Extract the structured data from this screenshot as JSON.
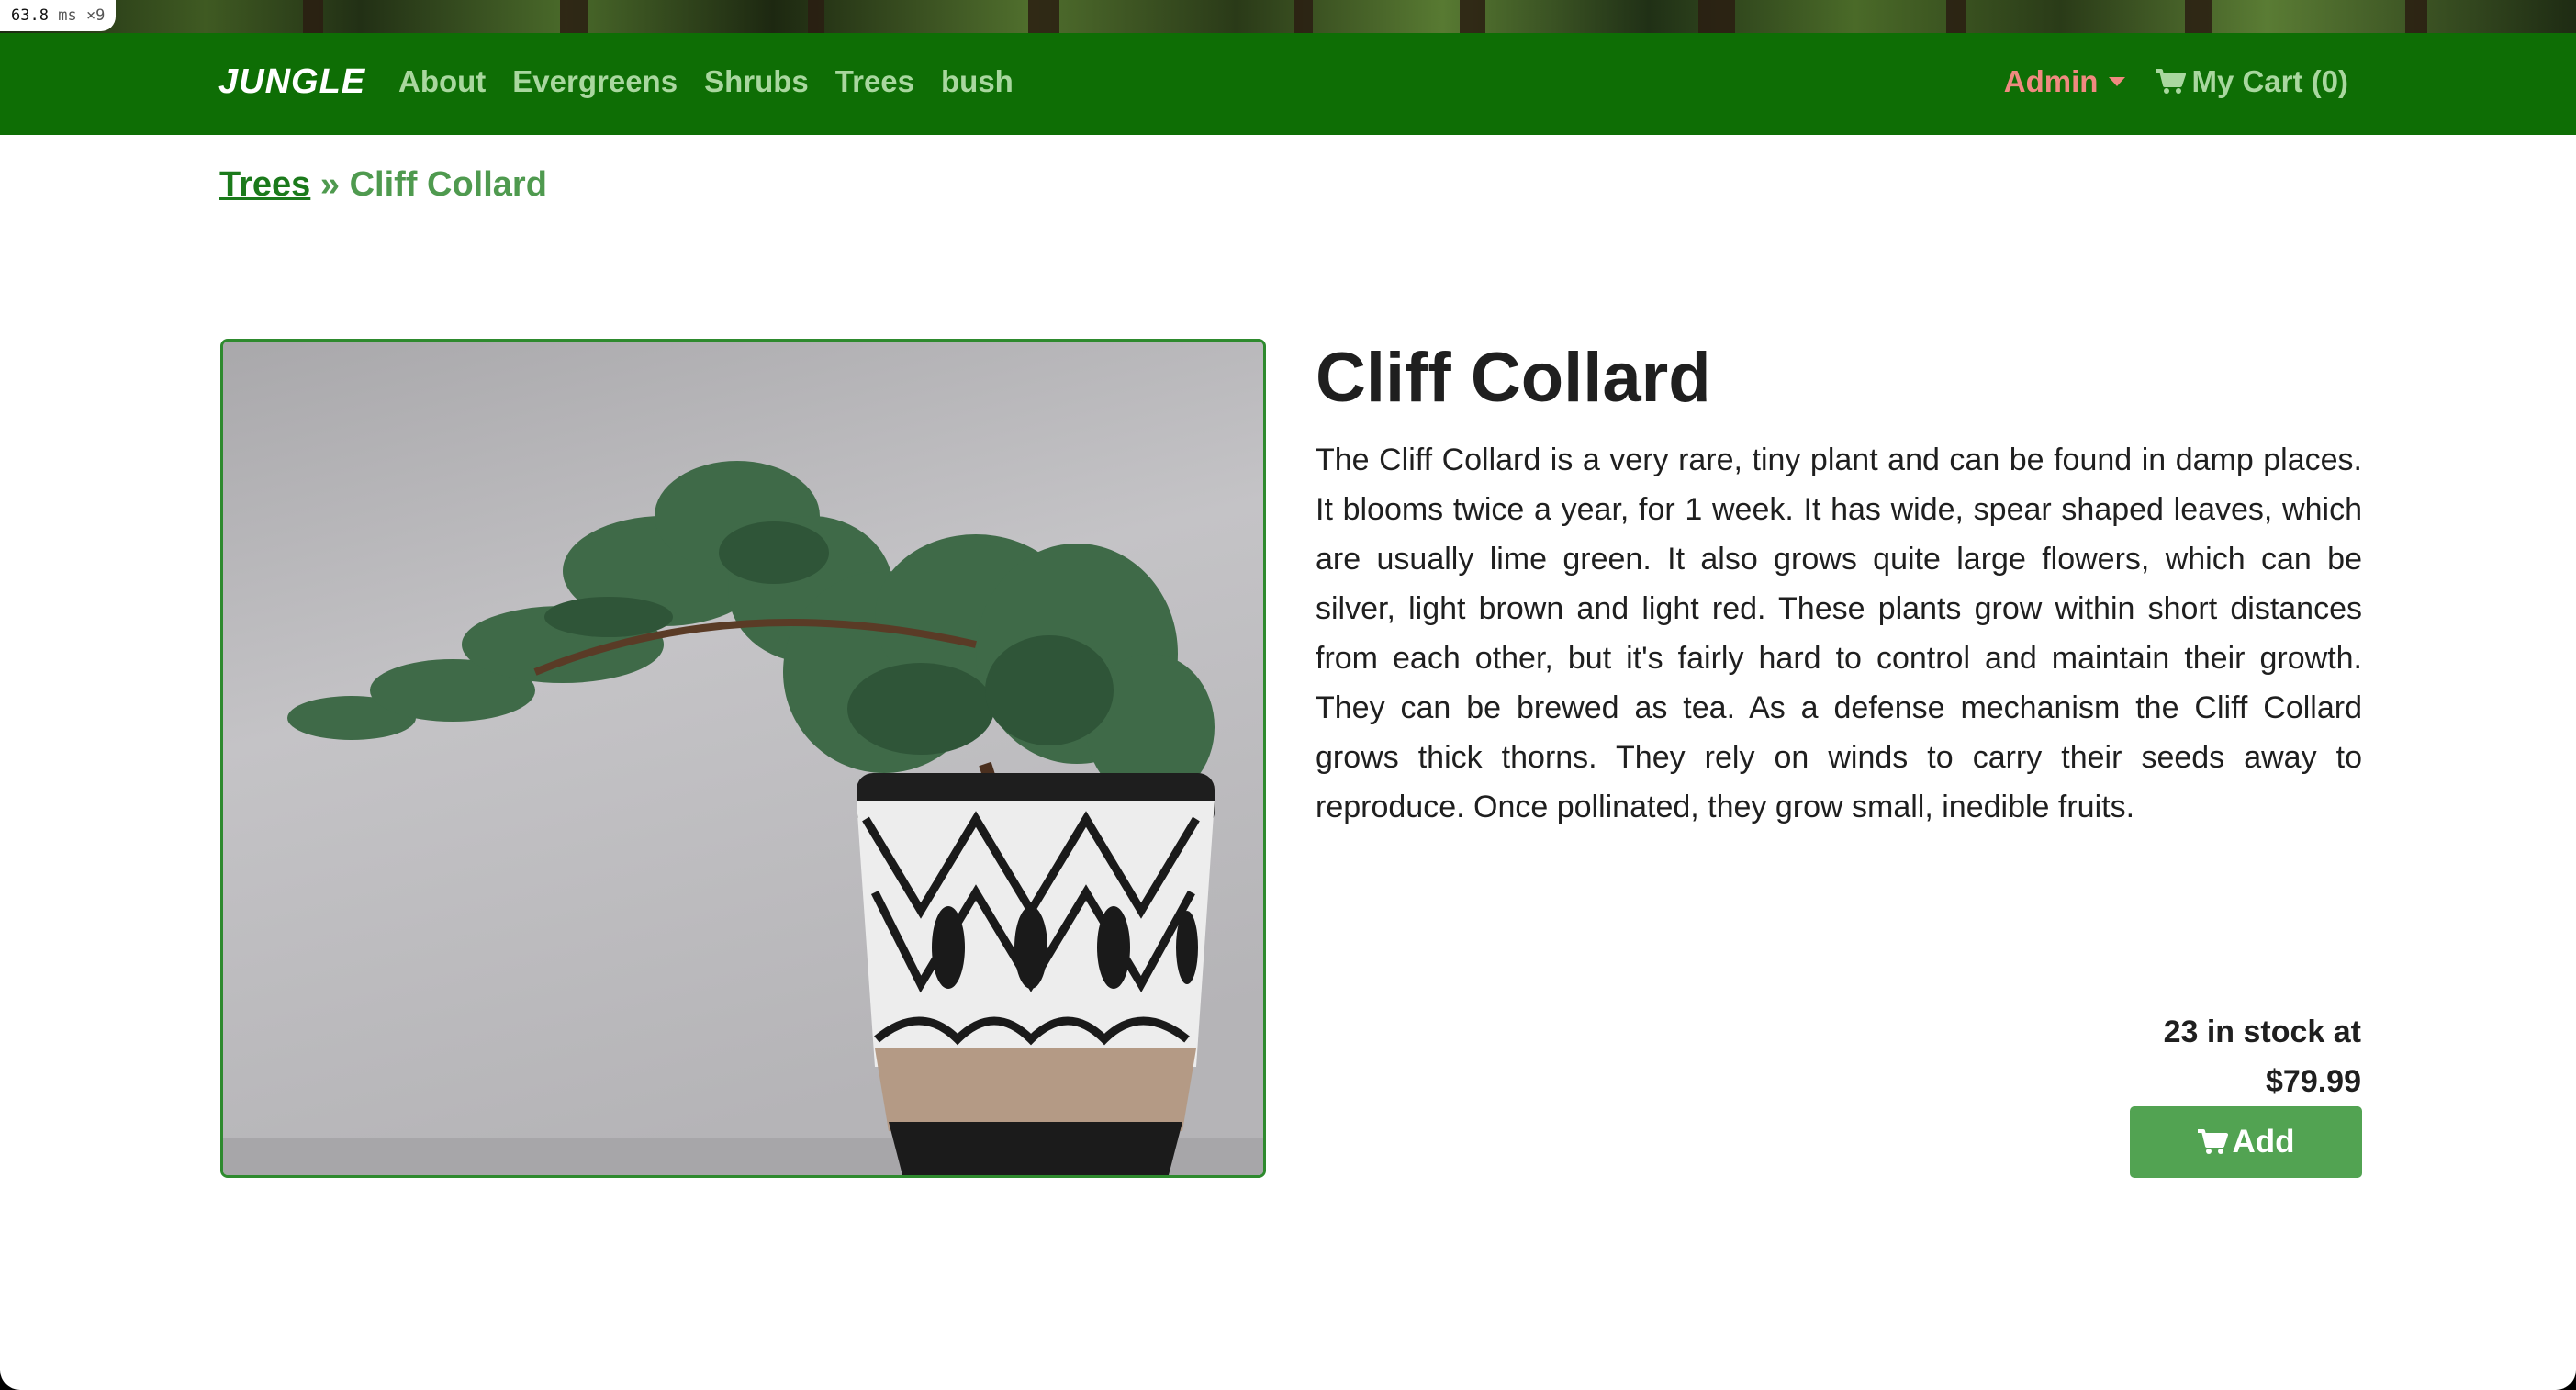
{
  "perf": {
    "value": "63.8",
    "unit": "ms",
    "multiplier": "×9"
  },
  "navbar": {
    "brand": "JUNGLE",
    "links": [
      "About",
      "Evergreens",
      "Shrubs",
      "Trees",
      "bush"
    ],
    "admin_label": "Admin",
    "cart_label": "My Cart (0)",
    "background": "#0e6e05",
    "link_color": "#a9d79f",
    "admin_color": "#f08a80"
  },
  "breadcrumb": {
    "parent": "Trees",
    "separator": "»",
    "current": "Cliff Collard"
  },
  "product": {
    "title": "Cliff Collard",
    "description": "The Cliff Collard is a very rare, tiny plant and can be found in damp places. It blooms twice a year, for 1 week. It has wide, spear shaped leaves, which are usually lime green. It also grows quite large flowers, which can be silver, light brown and light red. These plants grow within short distances from each other, but it's fairly hard to control and maintain their growth. They can be brewed as tea. As a defense mechanism the Cliff Collard grows thick thorns. They rely on winds to carry their seeds away to reproduce. Once pollinated, they grow small, inedible fruits.",
    "stock_line": "23 in stock at",
    "price": "$79.99",
    "add_label": "Add",
    "image_subject": "bonsai juniper in a black-and-white patterned pot"
  },
  "icons": {
    "cart": "cart-icon",
    "caret": "caret-down-icon"
  },
  "colors": {
    "accent_button": "#52a352",
    "image_border": "#2e8a2e"
  }
}
